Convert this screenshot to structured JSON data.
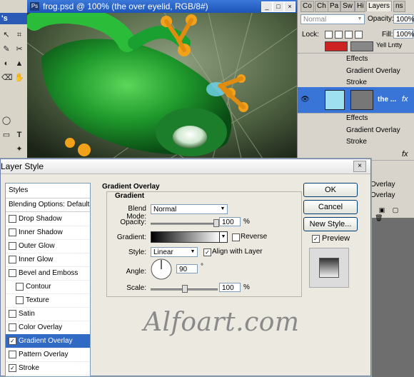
{
  "toolbox": {
    "title": "'s",
    "tools": [
      "↖",
      "⌗",
      "✎",
      "✂",
      "◐",
      "▲",
      "⌫",
      "✋",
      "T",
      "◯",
      "▭",
      "✦"
    ]
  },
  "document": {
    "title": "frog.psd @ 100% (the over eyelid, RGB/8#)",
    "icon_label": "Ps"
  },
  "layers_panel": {
    "tabs": [
      "Co",
      "Ch",
      "Pa",
      "Sw",
      "Hi",
      "Layers",
      "ns"
    ],
    "blend_mode": "Normal",
    "opacity_label": "Opacity:",
    "opacity_value": "100%",
    "lock_label": "Lock:",
    "fill_label": "Fill:",
    "fill_value": "100%",
    "top_layer_label": "Yell Lntty",
    "effects_label": "Effects",
    "sub1": [
      "Gradient Overlay",
      "Stroke"
    ],
    "selected_layer_name": "the ...",
    "fx_label": "fx",
    "sub2": [
      "Gradient Overlay",
      "Stroke"
    ],
    "lower_sub": [
      "Overlay",
      "Overlay"
    ]
  },
  "dialog": {
    "title": "Layer Style",
    "close": "×",
    "styles_header": "Styles",
    "blending_options": "Blending Options: Default",
    "style_items": [
      {
        "label": "Drop Shadow",
        "checked": false,
        "selected": false
      },
      {
        "label": "Inner Shadow",
        "checked": false,
        "selected": false
      },
      {
        "label": "Outer Glow",
        "checked": false,
        "selected": false
      },
      {
        "label": "Inner Glow",
        "checked": false,
        "selected": false
      },
      {
        "label": "Bevel and Emboss",
        "checked": false,
        "selected": false
      },
      {
        "label": "Contour",
        "checked": false,
        "selected": false
      },
      {
        "label": "Texture",
        "checked": false,
        "selected": false
      },
      {
        "label": "Satin",
        "checked": false,
        "selected": false
      },
      {
        "label": "Color Overlay",
        "checked": false,
        "selected": false
      },
      {
        "label": "Gradient Overlay",
        "checked": true,
        "selected": true
      },
      {
        "label": "Pattern Overlay",
        "checked": false,
        "selected": false
      },
      {
        "label": "Stroke",
        "checked": true,
        "selected": false
      }
    ],
    "section_title": "Gradient Overlay",
    "group_title": "Gradient",
    "blend_mode_label": "Blend Mode:",
    "blend_mode_value": "Normal",
    "opacity_label": "Opacity:",
    "opacity_value": "100",
    "opacity_pct": 1.0,
    "percent": "%",
    "gradient_label": "Gradient:",
    "reverse_label": "Reverse",
    "style_label": "Style:",
    "style_value": "Linear",
    "align_label": "Align with Layer",
    "angle_label": "Angle:",
    "angle_value": "90",
    "degree": "°",
    "scale_label": "Scale:",
    "scale_value": "100",
    "scale_pct": 0.5,
    "buttons": {
      "ok": "OK",
      "cancel": "Cancel",
      "new_style": "New Style...",
      "preview": "Preview"
    },
    "preview_checked": true
  },
  "watermark": "Alfoart.com"
}
